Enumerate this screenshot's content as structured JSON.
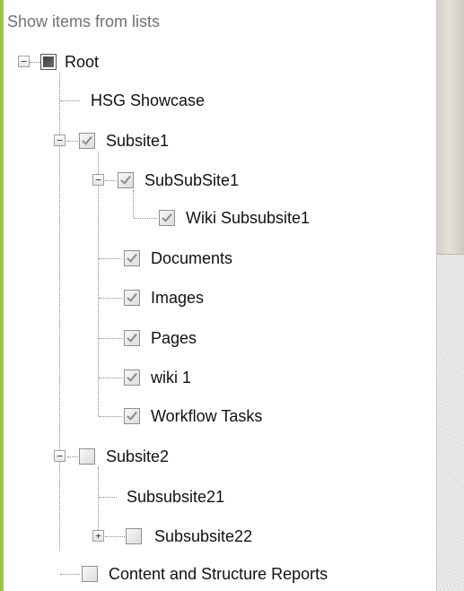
{
  "header": {
    "label": "Show items from lists"
  },
  "tree": {
    "root": {
      "label": "Root",
      "state": "partial"
    },
    "hsg_showcase": {
      "label": "HSG Showcase"
    },
    "subsite1": {
      "label": "Subsite1",
      "checked": true,
      "expanded": true
    },
    "subsubsite1": {
      "label": "SubSubSite1",
      "checked": true,
      "expanded": true
    },
    "wiki_subsubsite1": {
      "label": "Wiki Subsubsite1",
      "checked": true
    },
    "documents": {
      "label": "Documents",
      "checked": true
    },
    "images": {
      "label": "Images",
      "checked": true
    },
    "pages": {
      "label": "Pages",
      "checked": true
    },
    "wiki1": {
      "label": "wiki 1",
      "checked": true
    },
    "workflow_tasks": {
      "label": "Workflow Tasks",
      "checked": true
    },
    "subsite2": {
      "label": "Subsite2",
      "checked": false,
      "expanded": true
    },
    "subsubsite21": {
      "label": "Subsubsite21"
    },
    "subsubsite22": {
      "label": "Subsubsite22",
      "checked": false,
      "expanded": false
    },
    "content_reports": {
      "label": "Content and Structure Reports",
      "checked": false
    }
  },
  "colors": {
    "accent": "#9bc53d",
    "header_text": "#707070",
    "tree_lines": "#8a8a8a"
  },
  "icons": {
    "expanded": "minus-icon",
    "collapsed": "plus-icon",
    "checked": "checkmark-icon"
  }
}
